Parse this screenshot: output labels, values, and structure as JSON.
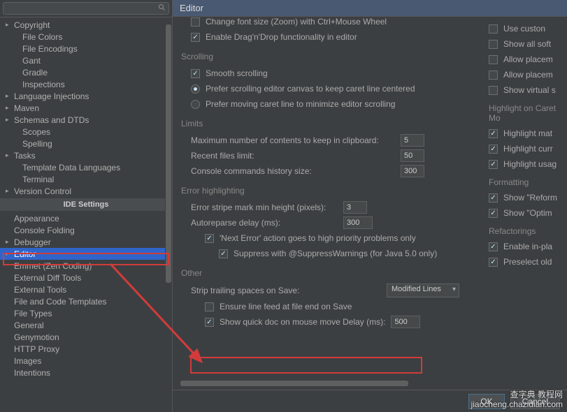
{
  "search": {
    "placeholder": ""
  },
  "sidebar": {
    "items": [
      {
        "label": "Copyright",
        "arrow": true
      },
      {
        "label": "File Colors",
        "arrow": false,
        "child": true
      },
      {
        "label": "File Encodings",
        "arrow": false,
        "child": true
      },
      {
        "label": "Gant",
        "arrow": false,
        "child": true
      },
      {
        "label": "Gradle",
        "arrow": false,
        "child": true
      },
      {
        "label": "Inspections",
        "arrow": false,
        "child": true
      },
      {
        "label": "Language Injections",
        "arrow": true
      },
      {
        "label": "Maven",
        "arrow": true
      },
      {
        "label": "Schemas and DTDs",
        "arrow": true
      },
      {
        "label": "Scopes",
        "arrow": false,
        "child": true
      },
      {
        "label": "Spelling",
        "arrow": false,
        "child": true
      },
      {
        "label": "Tasks",
        "arrow": true
      },
      {
        "label": "Template Data Languages",
        "arrow": false,
        "child": true
      },
      {
        "label": "Terminal",
        "arrow": false,
        "child": true
      },
      {
        "label": "Version Control",
        "arrow": true
      }
    ],
    "ide_header": "IDE Settings",
    "ide_items": [
      {
        "label": "Appearance"
      },
      {
        "label": "Console Folding"
      },
      {
        "label": "Debugger",
        "arrow": true
      },
      {
        "label": "Editor",
        "arrow": true,
        "selected": true
      },
      {
        "label": "Emmet (Zen Coding)"
      },
      {
        "label": "External Diff Tools"
      },
      {
        "label": "External Tools"
      },
      {
        "label": "File and Code Templates"
      },
      {
        "label": "File Types"
      },
      {
        "label": "General"
      },
      {
        "label": "Genymotion"
      },
      {
        "label": "HTTP Proxy"
      },
      {
        "label": "Images"
      },
      {
        "label": "Intentions"
      }
    ]
  },
  "header": {
    "title": "Editor"
  },
  "main": {
    "top": {
      "change_font": "Change font size (Zoom) with Ctrl+Mouse Wheel",
      "enable_dnd": "Enable Drag'n'Drop functionality in editor"
    },
    "scrolling": {
      "title": "Scrolling",
      "smooth": "Smooth scrolling",
      "prefer_center": "Prefer scrolling editor canvas to keep caret line centered",
      "prefer_move": "Prefer moving caret line to minimize editor scrolling"
    },
    "limits": {
      "title": "Limits",
      "clipboard_label": "Maximum number of contents to keep in clipboard:",
      "clipboard_value": "5",
      "recent_label": "Recent files limit:",
      "recent_value": "50",
      "console_label": "Console commands history size:",
      "console_value": "300"
    },
    "errhl": {
      "title": "Error highlighting",
      "stripe_label": "Error stripe mark min height (pixels):",
      "stripe_value": "3",
      "autoreparse_label": "Autoreparse delay (ms):",
      "autoreparse_value": "300",
      "next_error": "'Next Error' action goes to high priority problems only",
      "suppress": "Suppress with @SuppressWarnings (for Java 5.0 only)"
    },
    "other": {
      "title": "Other",
      "strip_label": "Strip trailing spaces on Save:",
      "strip_value": "Modified Lines",
      "ensure_lf": "Ensure line feed at file end on Save",
      "quick_doc": "Show quick doc on mouse move   Delay (ms):",
      "quick_doc_value": "500"
    }
  },
  "right": {
    "use_custom": "Use custon",
    "show_all_soft": "Show all soft",
    "allow_placem1": "Allow placem",
    "allow_placem2": "Allow placem",
    "show_virtual": "Show virtual s",
    "hoc_title": "Highlight on Caret Mo",
    "hl_mat": "Highlight mat",
    "hl_cur": "Highlight curr",
    "hl_usa": "Highlight usag",
    "fmt_title": "Formatting",
    "show_reform": "Show \"Reform",
    "show_optim": "Show \"Optim",
    "ref_title": "Refactorings",
    "enable_inpl": "Enable in-pla",
    "preselect": "Preselect old"
  },
  "footer": {
    "ok": "OK",
    "cancel": "Cancel"
  },
  "watermark": {
    "line1": "查字典 教程网",
    "line2": "jiaocheng.chazidian.com"
  }
}
